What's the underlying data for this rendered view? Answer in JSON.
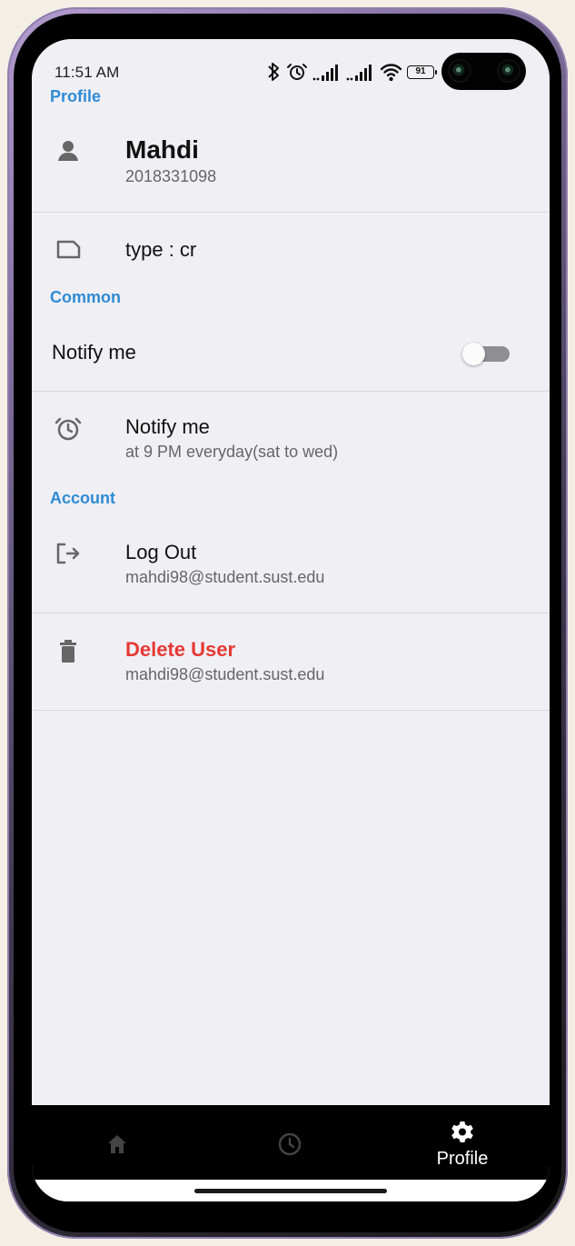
{
  "status_bar": {
    "time": "11:51 AM",
    "battery": "91"
  },
  "profile": {
    "section_title": "Profile",
    "name": "Mahdi",
    "id": "2018331098",
    "type_text": "type : cr"
  },
  "common": {
    "section_title": "Common",
    "notify_toggle_label": "Notify me",
    "notify_toggle_state": "off",
    "notify_title": "Notify me",
    "notify_subtitle": "at 9 PM everyday(sat to wed)"
  },
  "account": {
    "section_title": "Account",
    "logout_label": "Log Out",
    "logout_email": "mahdi98@student.sust.edu",
    "delete_label": "Delete User",
    "delete_email": "mahdi98@student.sust.edu"
  },
  "bottom_nav": {
    "profile_label": "Profile",
    "active_item": "Profile"
  },
  "icons": {
    "person": "person-icon",
    "label": "label-icon",
    "alarm": "alarm-icon",
    "logout": "logout-icon",
    "delete": "trash-icon",
    "home": "home-icon",
    "history": "clock-icon",
    "settings": "gear-icon"
  },
  "colors": {
    "accent": "#2f8bd3",
    "danger": "#e53935",
    "screen_background": "#f0eff4",
    "bottom_nav_background": "#000000"
  }
}
